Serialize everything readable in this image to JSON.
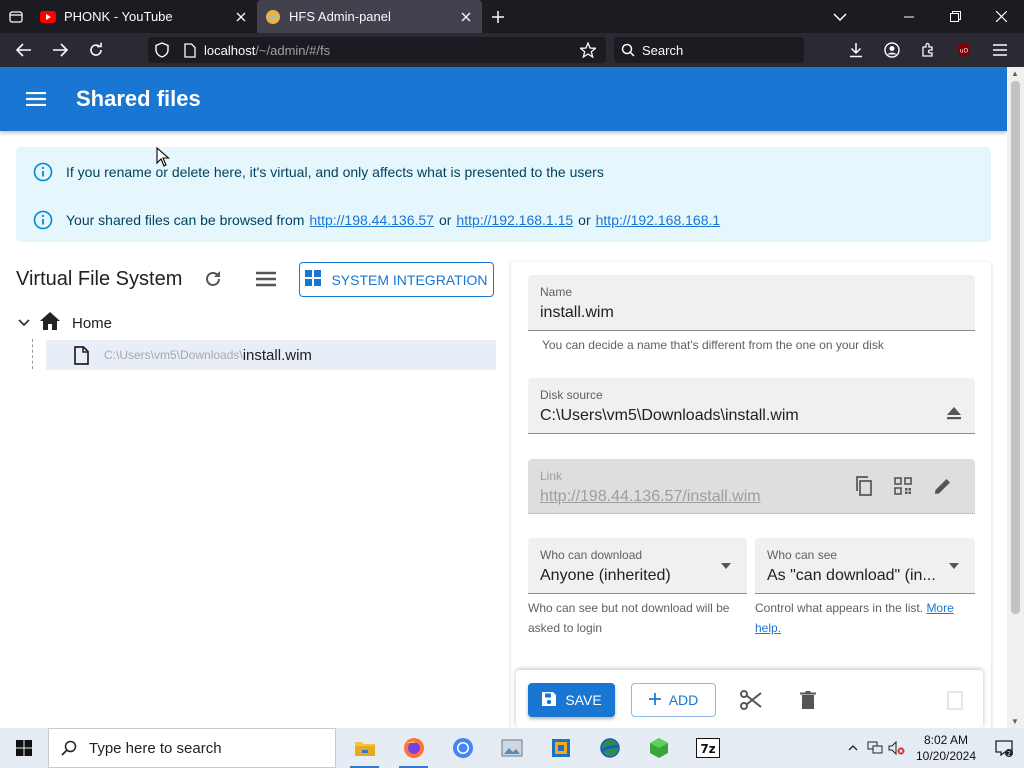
{
  "browser": {
    "tabs": [
      {
        "title": "PHONK - YouTube",
        "active": false
      },
      {
        "title": "HFS Admin-panel",
        "active": true
      }
    ],
    "url": {
      "host": "localhost",
      "path": "/~/admin/#/fs"
    },
    "search_placeholder": "Search"
  },
  "app": {
    "title": "Shared files"
  },
  "alerts": {
    "rename_notice": "If you rename or delete here, it's virtual, and only affects what is presented to the users",
    "browse_prefix": "Your shared files can be browsed from",
    "or1": "or",
    "or2": "or",
    "urls": [
      "http://198.44.136.57",
      "http://192.168.1.15",
      "http://192.168.168.1"
    ]
  },
  "vfs": {
    "title": "Virtual File System",
    "system_integration_label": "SYSTEM INTEGRATION",
    "root_label": "Home",
    "item": {
      "path": "C:\\Users\\vm5\\Downloads\\",
      "name": "install.wim"
    }
  },
  "details": {
    "name_label": "Name",
    "name_value": "install.wim",
    "name_help": "You can decide a name that's different from the one on your disk",
    "source_label": "Disk source",
    "source_value": "C:\\Users\\vm5\\Downloads\\install.wim",
    "link_label": "Link",
    "link_value": "http://198.44.136.57/install.wim",
    "download_label": "Who can download",
    "download_value": "Anyone (inherited)",
    "download_help": "Who can see but not download will be asked to login",
    "see_label": "Who can see",
    "see_value": "As \"can download\" (in...",
    "see_help": "Control what appears in the list.",
    "see_help_link": "More help."
  },
  "toolbar": {
    "save_label": "SAVE",
    "add_label": "ADD"
  },
  "taskbar": {
    "search_placeholder": "Type here to search",
    "time": "8:02 AM",
    "date": "10/20/2024"
  },
  "colors": {
    "primary": "#1976d2",
    "alert_bg": "#e5f6fd",
    "browser_dark": "#1c1b22"
  }
}
